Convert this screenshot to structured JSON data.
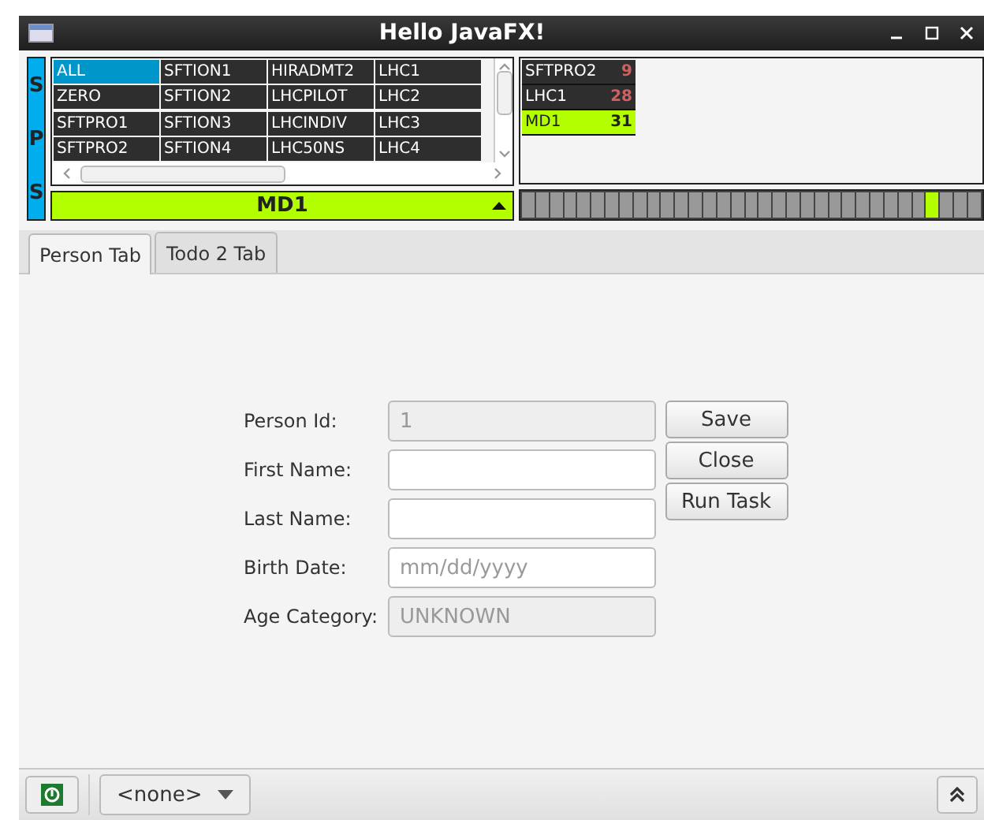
{
  "window": {
    "title": "Hello JavaFX!"
  },
  "accelerator": {
    "label": "SPS"
  },
  "users": {
    "rows": [
      [
        {
          "label": "ALL",
          "selected": true
        },
        {
          "label": "SFTION1",
          "selected": false
        },
        {
          "label": "HIRADMT2",
          "selected": false
        },
        {
          "label": "LHC1",
          "selected": false
        }
      ],
      [
        {
          "label": "ZERO",
          "selected": false
        },
        {
          "label": "SFTION2",
          "selected": false
        },
        {
          "label": "LHCPILOT",
          "selected": false
        },
        {
          "label": "LHC2",
          "selected": false
        }
      ],
      [
        {
          "label": "SFTPRO1",
          "selected": false
        },
        {
          "label": "SFTION3",
          "selected": false
        },
        {
          "label": "LHCINDIV",
          "selected": false
        },
        {
          "label": "LHC3",
          "selected": false
        }
      ],
      [
        {
          "label": "SFTPRO2",
          "selected": false
        },
        {
          "label": "SFTION4",
          "selected": false
        },
        {
          "label": "LHC50NS",
          "selected": false
        },
        {
          "label": "LHC4",
          "selected": false
        }
      ]
    ]
  },
  "selector": {
    "value": "MD1"
  },
  "cycles": [
    {
      "name": "SFTPRO2",
      "count": "9",
      "selected": false
    },
    {
      "name": "LHC1",
      "count": "28",
      "selected": false
    },
    {
      "name": "MD1",
      "count": "31",
      "selected": true
    }
  ],
  "timeline": [
    false,
    false,
    false,
    false,
    false,
    false,
    false,
    false,
    false,
    false,
    false,
    false,
    false,
    false,
    false,
    false,
    false,
    false,
    false,
    false,
    false,
    false,
    false,
    false,
    false,
    false,
    false,
    false,
    false,
    true,
    false,
    false,
    false
  ],
  "tabs": [
    {
      "label": "Person Tab",
      "selected": true
    },
    {
      "label": "Todo 2 Tab",
      "selected": false
    }
  ],
  "form": [
    {
      "label": "Person Id:",
      "value": "1",
      "disabled": true
    },
    {
      "label": "First Name:",
      "disabled": false
    },
    {
      "label": "Last Name:",
      "disabled": false
    },
    {
      "label": "Birth Date:",
      "placeholder": "mm/dd/yyyy",
      "disabled": false
    },
    {
      "label": "Age Category:",
      "value": "UNKNOWN",
      "disabled": true
    }
  ],
  "buttons": [
    "Save",
    "Close",
    "Run Task"
  ],
  "status_bar": {
    "combo": "<none>"
  }
}
